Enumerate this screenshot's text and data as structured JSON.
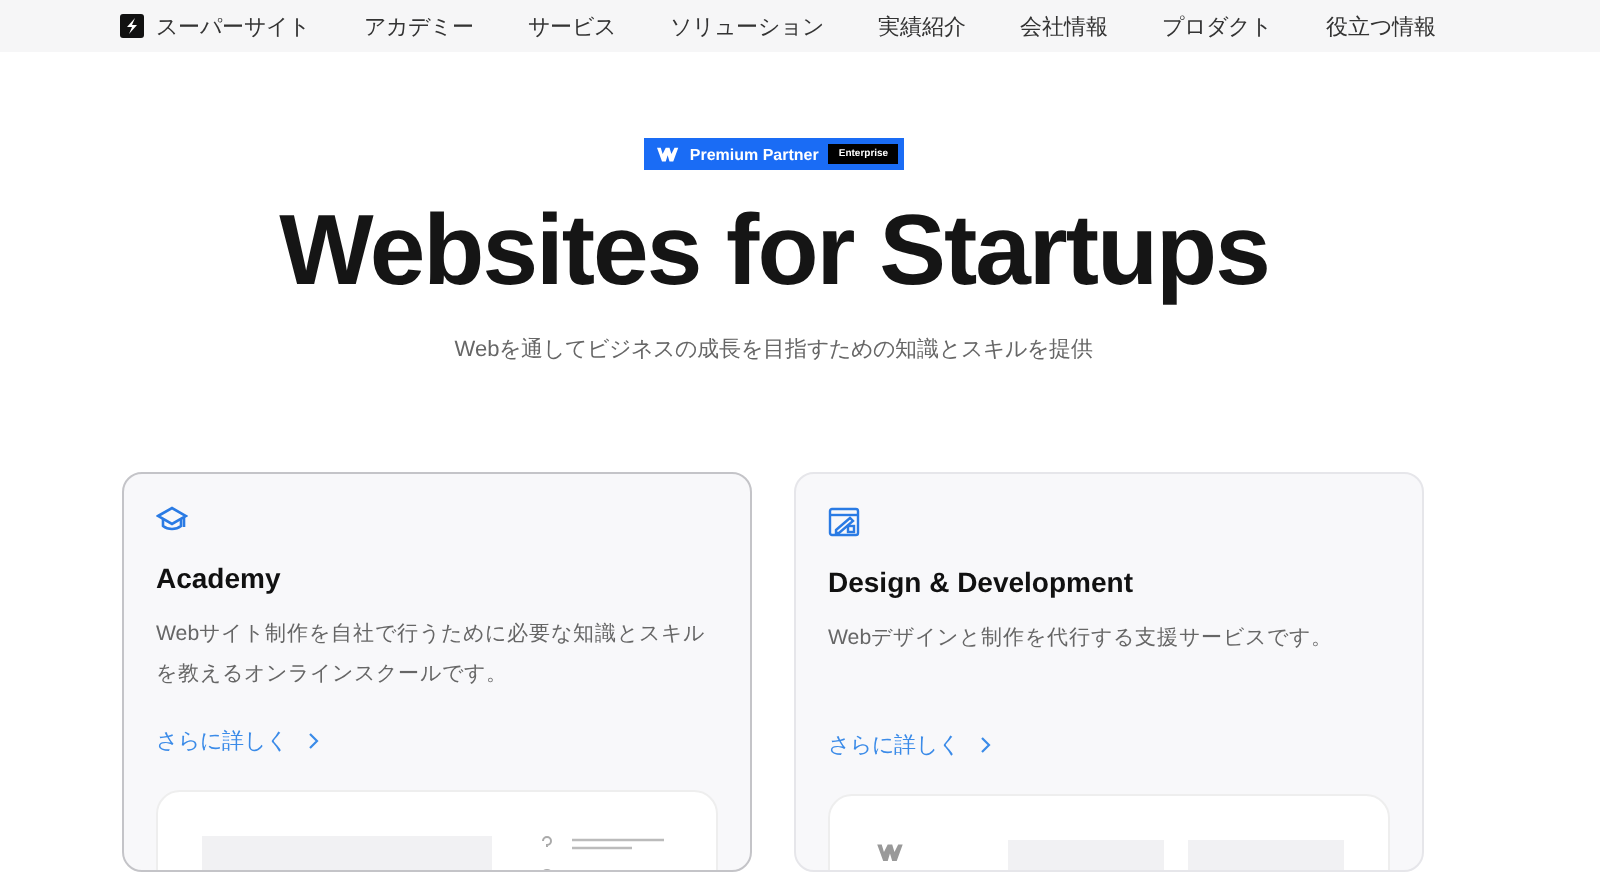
{
  "nav": {
    "brand": "スーパーサイト",
    "items": [
      "アカデミー",
      "サービス",
      "ソリューション",
      "実績紹介",
      "会社情報",
      "プロダクト",
      "役立つ情報"
    ]
  },
  "hero": {
    "badge": {
      "label": "Premium Partner",
      "tier": "Enterprise"
    },
    "title": "Websites for Startups",
    "subtitle": "Webを通してビジネスの成長を目指すための知識とスキルを提供"
  },
  "cards": [
    {
      "kind": "academy",
      "selected": true,
      "title": "Academy",
      "description": "Webサイト制作を自社で行うために必要な知識とスキルを教えるオンラインスクールです。",
      "link": "さらに詳しく"
    },
    {
      "kind": "design",
      "selected": false,
      "title": "Design & Development",
      "description": "Webデザインと制作を代行する支援サービスです。",
      "link": "さらに詳しく"
    }
  ]
}
